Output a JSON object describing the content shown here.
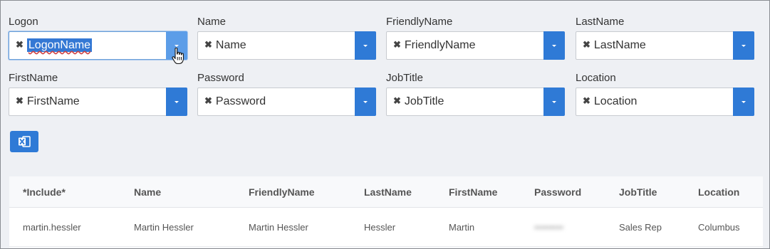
{
  "fields": [
    {
      "label": "Logon",
      "value": "LogonName"
    },
    {
      "label": "Name",
      "value": "Name"
    },
    {
      "label": "FriendlyName",
      "value": "FriendlyName"
    },
    {
      "label": "LastName",
      "value": "LastName"
    },
    {
      "label": "FirstName",
      "value": "FirstName"
    },
    {
      "label": "Password",
      "value": "Password"
    },
    {
      "label": "JobTitle",
      "value": "JobTitle"
    },
    {
      "label": "Location",
      "value": "Location"
    }
  ],
  "clear_glyph": "✖",
  "icons": {
    "clear": "x-icon",
    "dropdown": "caret-down-icon",
    "cursor": "hand-pointer-icon",
    "export": "excel-icon"
  },
  "colors": {
    "accent": "#2f7ad6",
    "background": "#eef0f4"
  },
  "table": {
    "headers": [
      "*Include*",
      "Name",
      "FriendlyName",
      "LastName",
      "FirstName",
      "Password",
      "JobTitle",
      "Location"
    ],
    "rows": [
      [
        "martin.hessler",
        "Martin Hessler",
        "Martin Hessler",
        "Hessler",
        "Martin",
        "•••••••••",
        "Sales Rep",
        "Columbus"
      ]
    ]
  }
}
